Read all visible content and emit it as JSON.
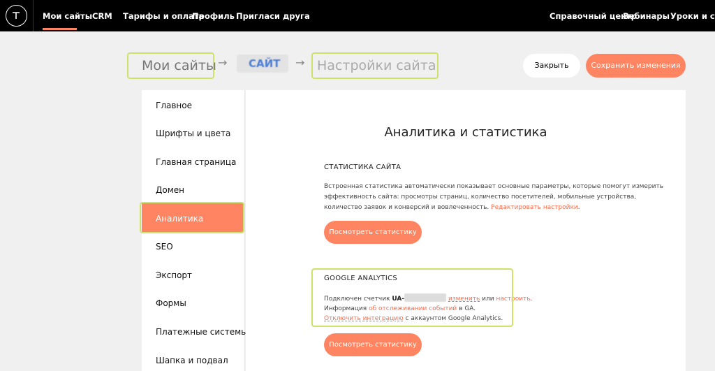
{
  "nav": {
    "items": [
      "Мои сайты",
      "CRM",
      "Тарифы и оплата",
      "Профиль",
      "Пригласи друга"
    ],
    "right": [
      "Справочный центр",
      "Вебинары",
      "Уроки и статьи"
    ]
  },
  "breadcrumb": {
    "my_sites": "Мои сайты",
    "site": "САЙТ",
    "settings": "Настройки сайта",
    "arrow": "→"
  },
  "toolbar": {
    "close_label": "Закрыть",
    "save_label": "Сохранить изменения"
  },
  "sidebar": {
    "items": [
      "Главное",
      "Шрифты и цвета",
      "Главная страница",
      "Домен",
      "Аналитика",
      "SEO",
      "Экспорт",
      "Формы",
      "Платежные системы",
      "Шапка и подвал"
    ],
    "active_index": 4
  },
  "main": {
    "title": "Аналитика и статистика",
    "stats": {
      "heading": "СТАТИСТИКА САЙТА",
      "line1": "Встроенная статистика автоматически показывает основные параметры, которые помогут измерить",
      "line2": "эффективность сайта: просмотры страниц, количество посетителей, мобильные устройства,",
      "line3": "количество заявок и конверсий и вовлеченность.",
      "edit_link": "Редактировать настройки",
      "line3_end": ".",
      "button": "Посмотреть статистику"
    },
    "ga": {
      "heading": "GOOGLE ANALYTICS",
      "connected_prefix": "Подключен счетчик",
      "counter_prefix": "UA-",
      "change_link": "изменить",
      "or": "или",
      "configure_link": "настроить",
      "dot": ".",
      "info_prefix": "Информация",
      "events_link": "об отслеживании событий",
      "info_suffix": "в GA.",
      "disconnect_link": "Отключить интеграцию",
      "disconnect_suffix": "с аккаунтом Google Analytics.",
      "button": "Посмотреть статистику"
    }
  },
  "colors": {
    "accent": "#ff8562",
    "highlight": "#cde26a"
  }
}
